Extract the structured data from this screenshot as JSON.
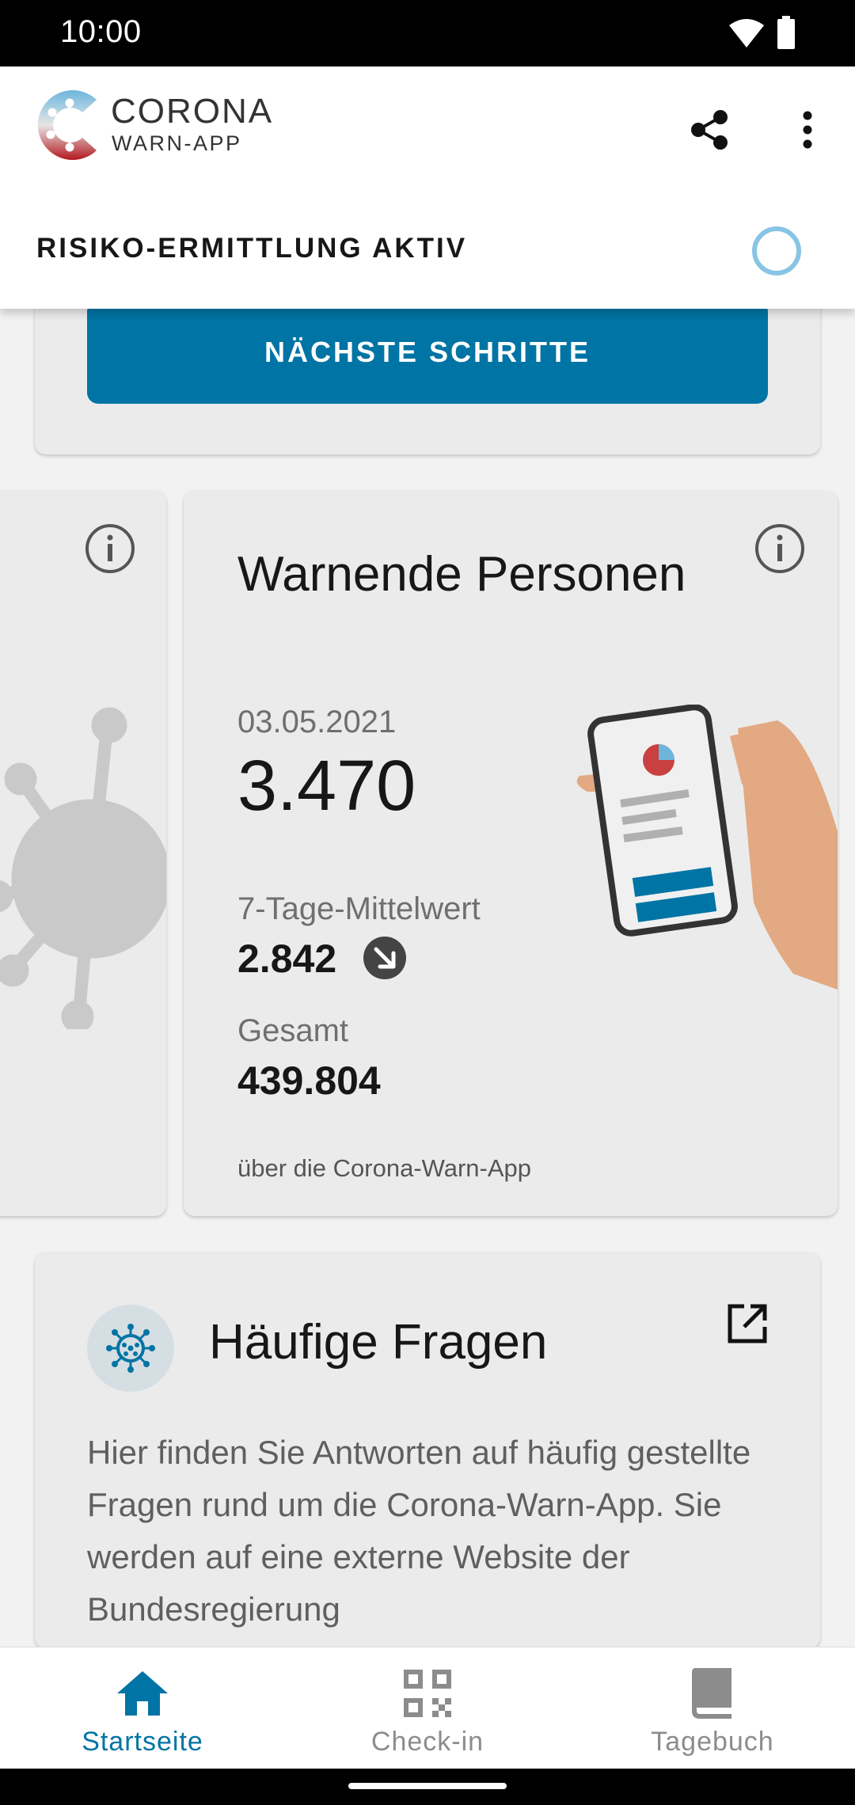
{
  "status_bar": {
    "time": "10:00"
  },
  "app_bar": {
    "logo_line1": "CORONA",
    "logo_line2": "WARN-APP",
    "risk_status": "RISIKO-ERMITTLUNG AKTIV"
  },
  "top_card": {
    "button_label": "NÄCHSTE SCHRITTE"
  },
  "stats_card": {
    "title": "Warnende Personen",
    "date": "03.05.2021",
    "value": "3.470",
    "avg_label": "7-Tage-Mittelwert",
    "avg_value": "2.842",
    "avg_trend": "down",
    "total_label": "Gesamt",
    "total_value": "439.804",
    "footnote": "über die Corona-Warn-App"
  },
  "faq_card": {
    "title": "Häufige Fragen",
    "body": "Hier finden Sie Antworten auf häufig gestellte Fragen rund um die Corona-Warn-App. Sie werden auf eine externe Website der Bundesregierung"
  },
  "bottom_nav": {
    "items": [
      {
        "label": "Startseite",
        "icon": "home-icon",
        "active": true
      },
      {
        "label": "Check-in",
        "icon": "qr-code-icon",
        "active": false
      },
      {
        "label": "Tagebuch",
        "icon": "book-icon",
        "active": false
      }
    ]
  },
  "colors": {
    "primary": "#0074a4",
    "risk_indicator": "#88c4e4",
    "card_bg": "#ebebeb",
    "text_secondary": "#6f6f6f"
  }
}
